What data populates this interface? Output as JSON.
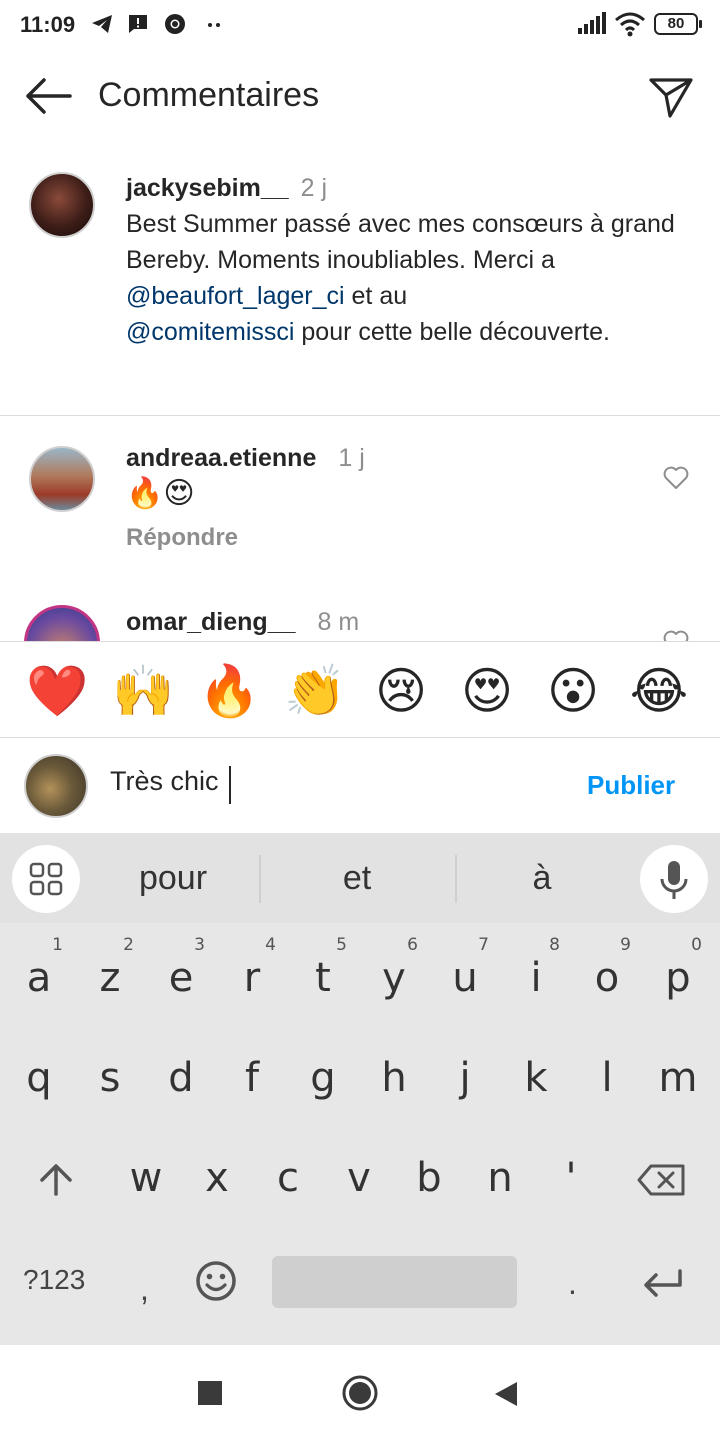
{
  "status_bar": {
    "time": "11:09",
    "battery": "80"
  },
  "header": {
    "title": "Commentaires"
  },
  "caption": {
    "username": "jackysebim__",
    "time": "2 j",
    "text_1": "Best Summer passé avec mes consœurs à grand Bereby. Moments inoubliables. Merci a ",
    "mention_1": "@beaufort_lager_ci",
    "text_2": " et au ",
    "mention_2": "@comitemissci",
    "text_3": " pour cette belle découverte."
  },
  "comments": [
    {
      "username": "andreaa.etienne",
      "time": "1 j",
      "text": "🔥😍",
      "reply": "Répondre"
    },
    {
      "username": "omar_dieng__",
      "time": "8 m"
    }
  ],
  "emoji_bar": [
    "❤️",
    "🙌",
    "🔥",
    "👏",
    "😢",
    "😍",
    "😮",
    "😂"
  ],
  "input": {
    "value": "Très chic",
    "publish": "Publier"
  },
  "keyboard": {
    "suggestions": [
      "pour",
      "et",
      "à"
    ],
    "row1": [
      {
        "k": "a",
        "n": "1"
      },
      {
        "k": "z",
        "n": "2"
      },
      {
        "k": "e",
        "n": "3"
      },
      {
        "k": "r",
        "n": "4"
      },
      {
        "k": "t",
        "n": "5"
      },
      {
        "k": "y",
        "n": "6"
      },
      {
        "k": "u",
        "n": "7"
      },
      {
        "k": "i",
        "n": "8"
      },
      {
        "k": "o",
        "n": "9"
      },
      {
        "k": "p",
        "n": "0"
      }
    ],
    "row2": [
      "q",
      "s",
      "d",
      "f",
      "g",
      "h",
      "j",
      "k",
      "l",
      "m"
    ],
    "row3": [
      "w",
      "x",
      "c",
      "v",
      "b",
      "n",
      "'"
    ],
    "sym": "?123",
    "comma": ",",
    "period": "."
  }
}
